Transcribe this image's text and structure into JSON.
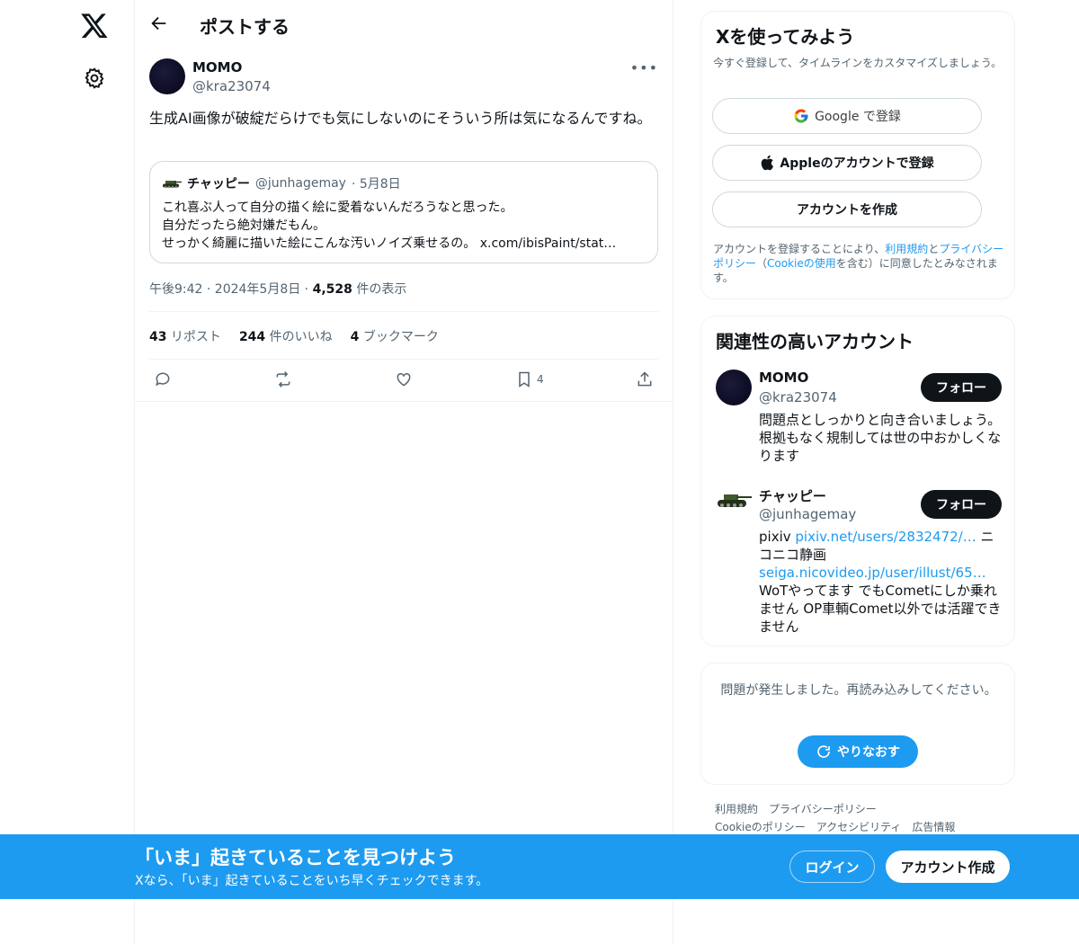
{
  "nav": {
    "logo_icon": "x-logo-icon",
    "settings_icon": "gear-icon"
  },
  "header": {
    "back_icon": "arrow-left-icon",
    "title": "ポストする"
  },
  "post": {
    "author_name": "MOMO",
    "author_handle": "@kra23074",
    "text": "生成AI画像が破綻だらけでも気にしないのにそういう所は気になるんですね。",
    "quote": {
      "author_name": "チャッピー",
      "author_handle": "@junhagemay",
      "date": "· 5月8日",
      "line1": "これ喜ぶ人って自分の描く絵に愛着ないんだろうなと思った。",
      "line2": "自分だったら絶対嫌だもん。",
      "line3": "せっかく綺麗に描いた絵にこんな汚いノイズ乗せるの。 x.com/ibisPaint/stat…"
    },
    "time": "午後9:42 · 2024年5月8日 · ",
    "views_count": "4,528",
    "views_label": " 件の表示",
    "stats": {
      "reposts_count": "43",
      "reposts_label": " リポスト",
      "likes_count": "244",
      "likes_label": " 件のいいね",
      "bookmarks_count": "4",
      "bookmarks_label": " ブックマーク"
    },
    "actions": {
      "bookmark_count": "4"
    }
  },
  "signup": {
    "title": "Xを使ってみよう",
    "subtitle": "今すぐ登録して、タイムラインをカスタマイズしましょう。",
    "google_label": "Google で登録",
    "apple_label": "Appleのアカウントで登録",
    "create_label": "アカウントを作成",
    "legal_1": "アカウントを登録することにより、",
    "legal_terms": "利用規約",
    "legal_and": "と",
    "legal_privacy": "プライバシーポリシー",
    "legal_2": "（",
    "legal_cookie": "Cookieの使用",
    "legal_3": "を含む）に同意したとみなされます。"
  },
  "reco": {
    "title": "関連性の高いアカウント",
    "accounts": [
      {
        "name": "MOMO",
        "handle": "@kra23074",
        "follow_label": "フォロー",
        "bio": "問題点としっかりと向き合いましょう。 根拠もなく規制しては世の中おかしくなります"
      },
      {
        "name": "チャッピー",
        "handle": "@junhagemay",
        "follow_label": "フォロー",
        "bio_1": "pixiv ",
        "bio_link1": "pixiv.net/users/2832472/…",
        "bio_2": " ニコニコ静画 ",
        "bio_link2": "seiga.nicovideo.jp/user/illust/65…",
        "bio_3": " WoTやってます でもCometにしか乗れません OP車輌Comet以外では活躍できません"
      }
    ]
  },
  "error": {
    "text": "問題が発生しました。再読み込みしてください。",
    "retry_label": "やりなおす"
  },
  "footer": {
    "terms": "利用規約",
    "privacy": "プライバシーポリシー",
    "cookie": "Cookieのポリシー",
    "accessibility": "アクセシビリティ",
    "ads": "広告情報"
  },
  "bottom_bar": {
    "title": "「いま」起きていることを見つけよう",
    "subtitle": "Xなら、「いま」起きていることをいち早くチェックできます。",
    "login_label": "ログイン",
    "create_label": "アカウント作成"
  },
  "colors": {
    "accent": "#1d9bf0",
    "text": "#0f1419",
    "muted": "#536471",
    "border": "#cfd9de"
  }
}
